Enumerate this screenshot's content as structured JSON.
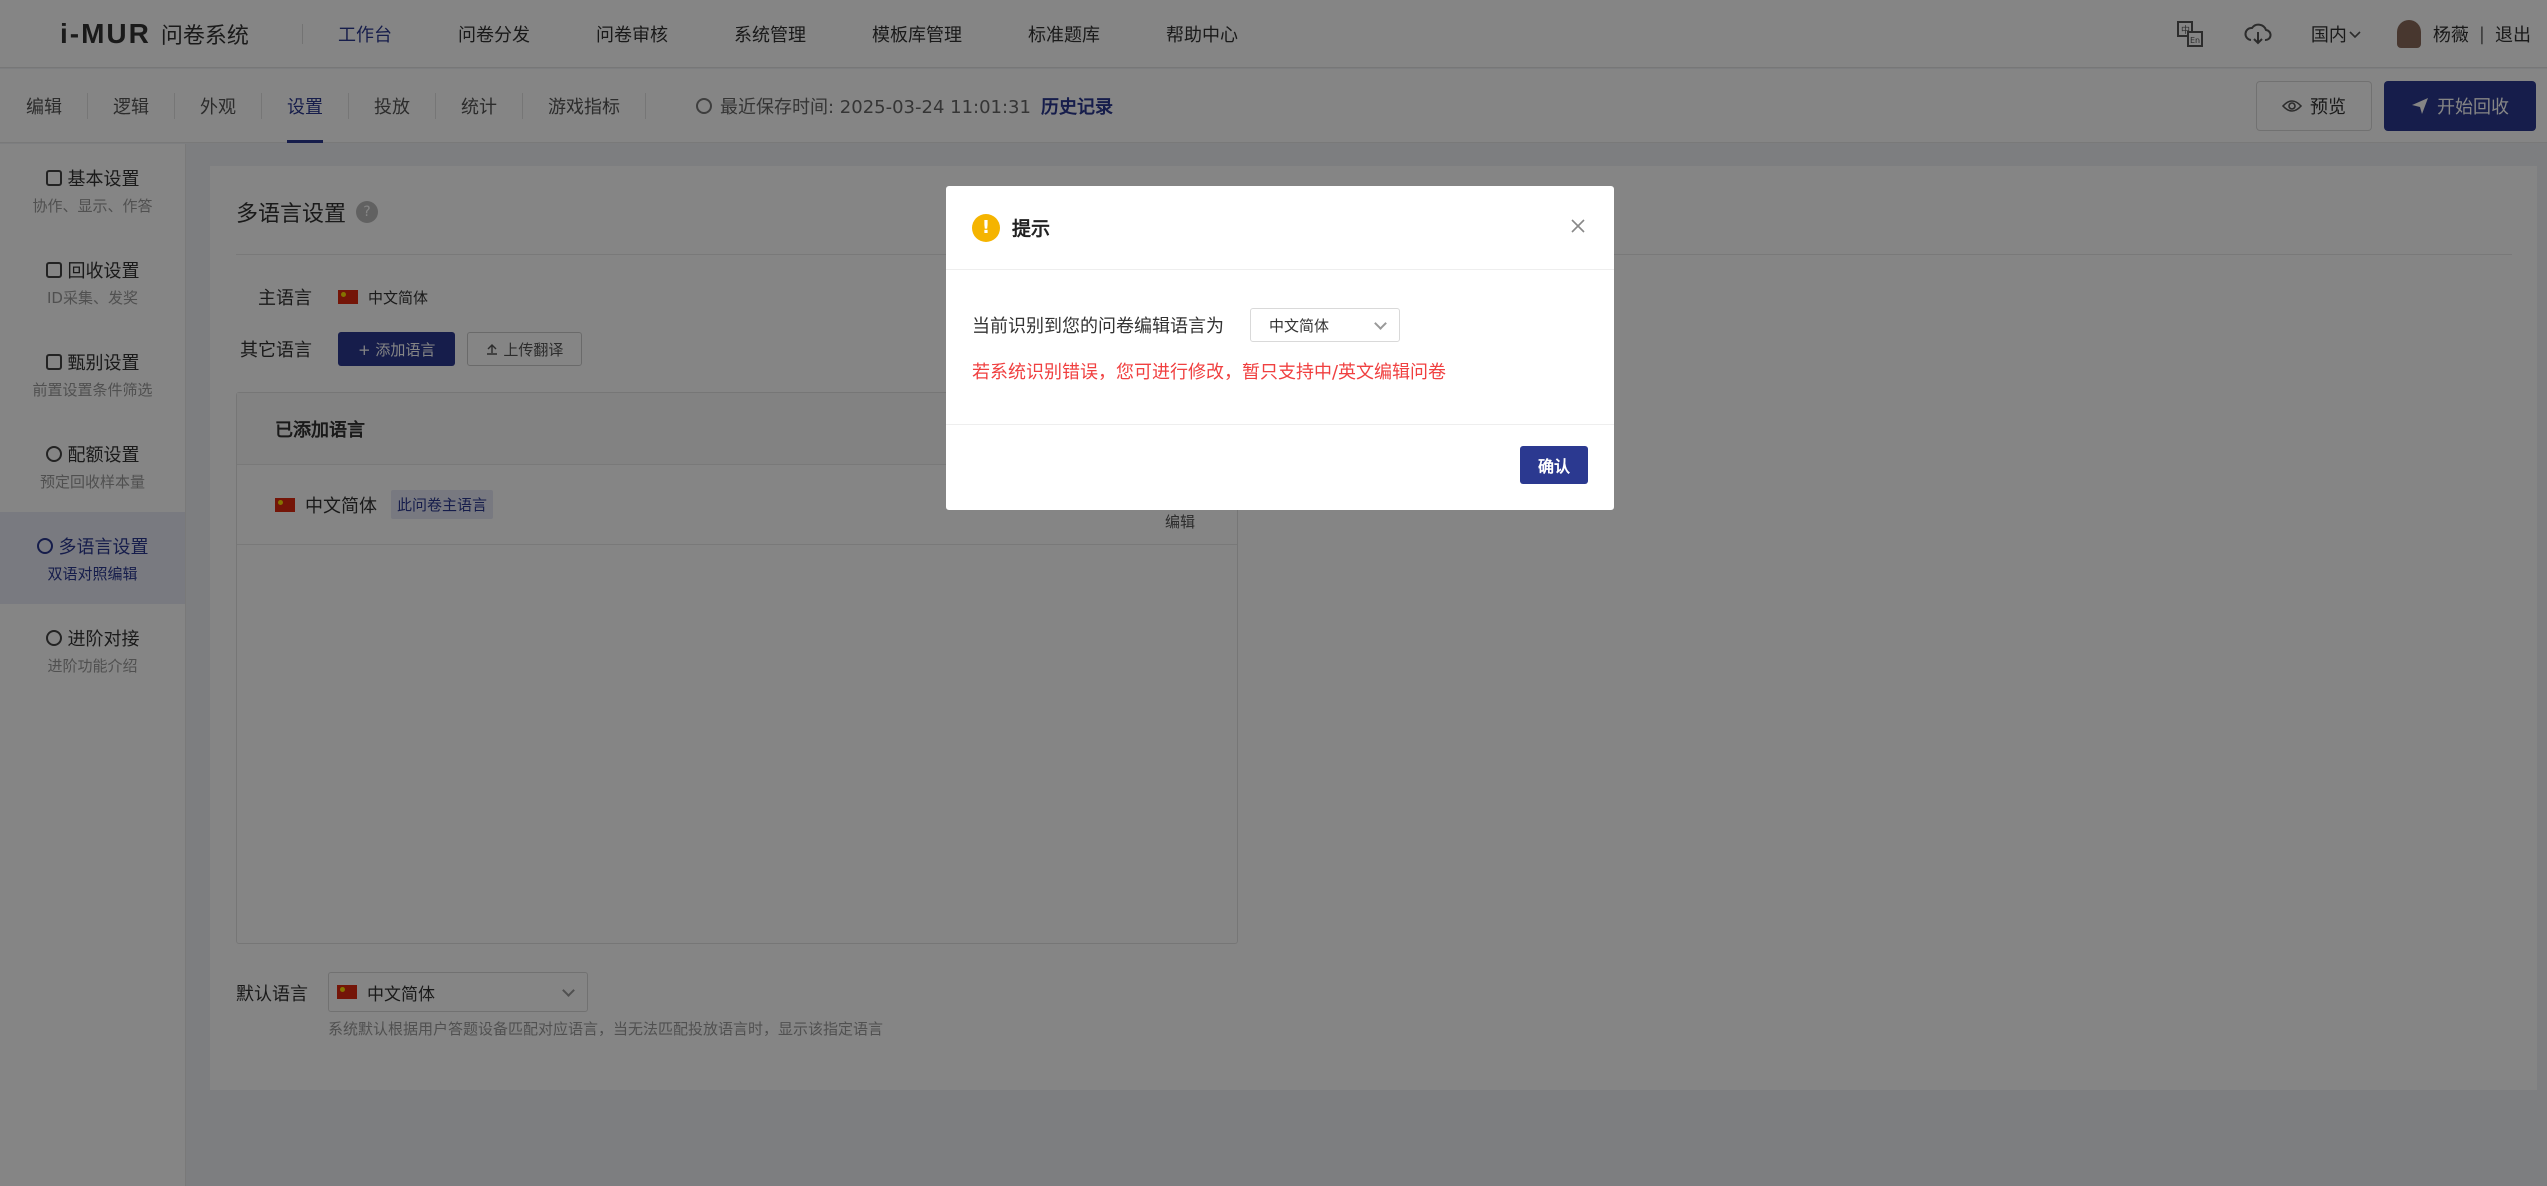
{
  "app": {
    "logo_mark": "i-MUR",
    "logo_text": "问卷系统"
  },
  "nav": {
    "items": [
      "工作台",
      "问卷分发",
      "问卷审核",
      "系统管理",
      "模板库管理",
      "标准题库",
      "帮助中心"
    ],
    "active": "工作台"
  },
  "topright": {
    "region": "国内",
    "user": "杨薇",
    "logout": "退出",
    "separator": "|"
  },
  "tabs": {
    "items": [
      "编辑",
      "逻辑",
      "外观",
      "设置",
      "投放",
      "统计",
      "游戏指标"
    ],
    "active": "设置"
  },
  "save": {
    "text": "最近保存时间: 2025-03-24 11:01:31",
    "history": "历史记录"
  },
  "actions": {
    "preview": "预览",
    "start": "开始回收"
  },
  "sidebar": {
    "items": [
      {
        "title": "基本设置",
        "sub": "协作、显示、作答",
        "icon": "layers-icon"
      },
      {
        "title": "回收设置",
        "sub": "ID采集、发奖",
        "icon": "doc-icon"
      },
      {
        "title": "甄别设置",
        "sub": "前置设置条件筛选",
        "icon": "hierarchy-icon"
      },
      {
        "title": "配额设置",
        "sub": "预定回收样本量",
        "icon": "quota-icon"
      },
      {
        "title": "多语言设置",
        "sub": "双语对照编辑",
        "icon": "globe-icon"
      },
      {
        "title": "进阶对接",
        "sub": "进阶功能介绍",
        "icon": "link-icon"
      }
    ],
    "active": 4
  },
  "content": {
    "title": "多语言设置",
    "help": "?",
    "main_lang_label": "主语言",
    "main_lang": "中文简体",
    "other_lang_label": "其它语言",
    "add_button": "+ 添加语言",
    "upload_button": "上传翻译",
    "table_header": "已添加语言",
    "row_lang": "中文简体",
    "row_badge": "此问卷主语言",
    "row_edit": "编辑",
    "default_label": "默认语言",
    "default_value": "中文简体",
    "default_hint": "系统默认根据用户答题设备匹配对应语言，当无法匹配投放语言时，显示该指定语言"
  },
  "modal": {
    "title": "提示",
    "warn_symbol": "!",
    "message": "当前识别到您的问卷编辑语言为",
    "select_value": "中文简体",
    "error": "若系统识别错误，您可进行修改，暂只支持中/英文编辑问卷",
    "confirm": "确认"
  },
  "colors": {
    "accent": "#2b3990",
    "error": "#f04040",
    "warning": "#f5b400"
  }
}
